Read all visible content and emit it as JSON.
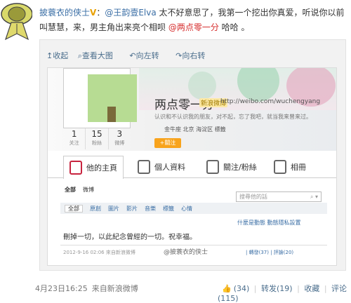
{
  "post": {
    "author": "披蓑衣的侠士",
    "verified_mark": "V",
    "colon": "：",
    "mention1": "@王韵壹Elva",
    "text1": " 太不好意思了，我第一个挖出你真爱，听说你以前叫慧慧，来，男主角出来亮个相呗 ",
    "mention2": "@两点零一分",
    "text2": " 哈哈 。"
  },
  "image_tools": {
    "collapse": "↥收起",
    "view_large": "查看大图",
    "rotate_left": "向左转",
    "rotate_right": "向右转"
  },
  "screenshot": {
    "profile_name": "两点零一分",
    "profile_tag": "新浪微博",
    "profile_url": "http://weibo.com/wuchengyang",
    "bio": "认识和不认识我的朋友，对不起，忘了我吧，就当我来曾来过。",
    "meta": "金牛座   北京 海淀区   標籤",
    "follow_label": "+關注",
    "stats": [
      {
        "num": "1",
        "label": "关注"
      },
      {
        "num": "15",
        "label": "粉絲"
      },
      {
        "num": "3",
        "label": "微博"
      }
    ],
    "nav": [
      "他的主頁",
      "個人資料",
      "關注/粉絲",
      "相冊"
    ],
    "sub_tabs": [
      "全部",
      "微博"
    ],
    "search_placeholder": "搜尋他的話",
    "filters": [
      "全部",
      "原創",
      "圖片",
      "影片",
      "音樂",
      "標籤",
      "心情"
    ],
    "actions": "什麼是動態  動態隱私設置",
    "weibo_text": "刪掉一切，以此紀念曾經的一切。祝幸福。",
    "time": "2012-9-16 02:06  來自新浪微博",
    "stats_line": "| 轉發(37) | 評論(20)",
    "watermark": "@披蓑衣的侠士"
  },
  "footer": {
    "time": "4月23日16:25",
    "source": "来自新浪微博",
    "like": "(34)",
    "repost": "转发(19)",
    "fav": "收藏",
    "comment": "评论(115)"
  }
}
